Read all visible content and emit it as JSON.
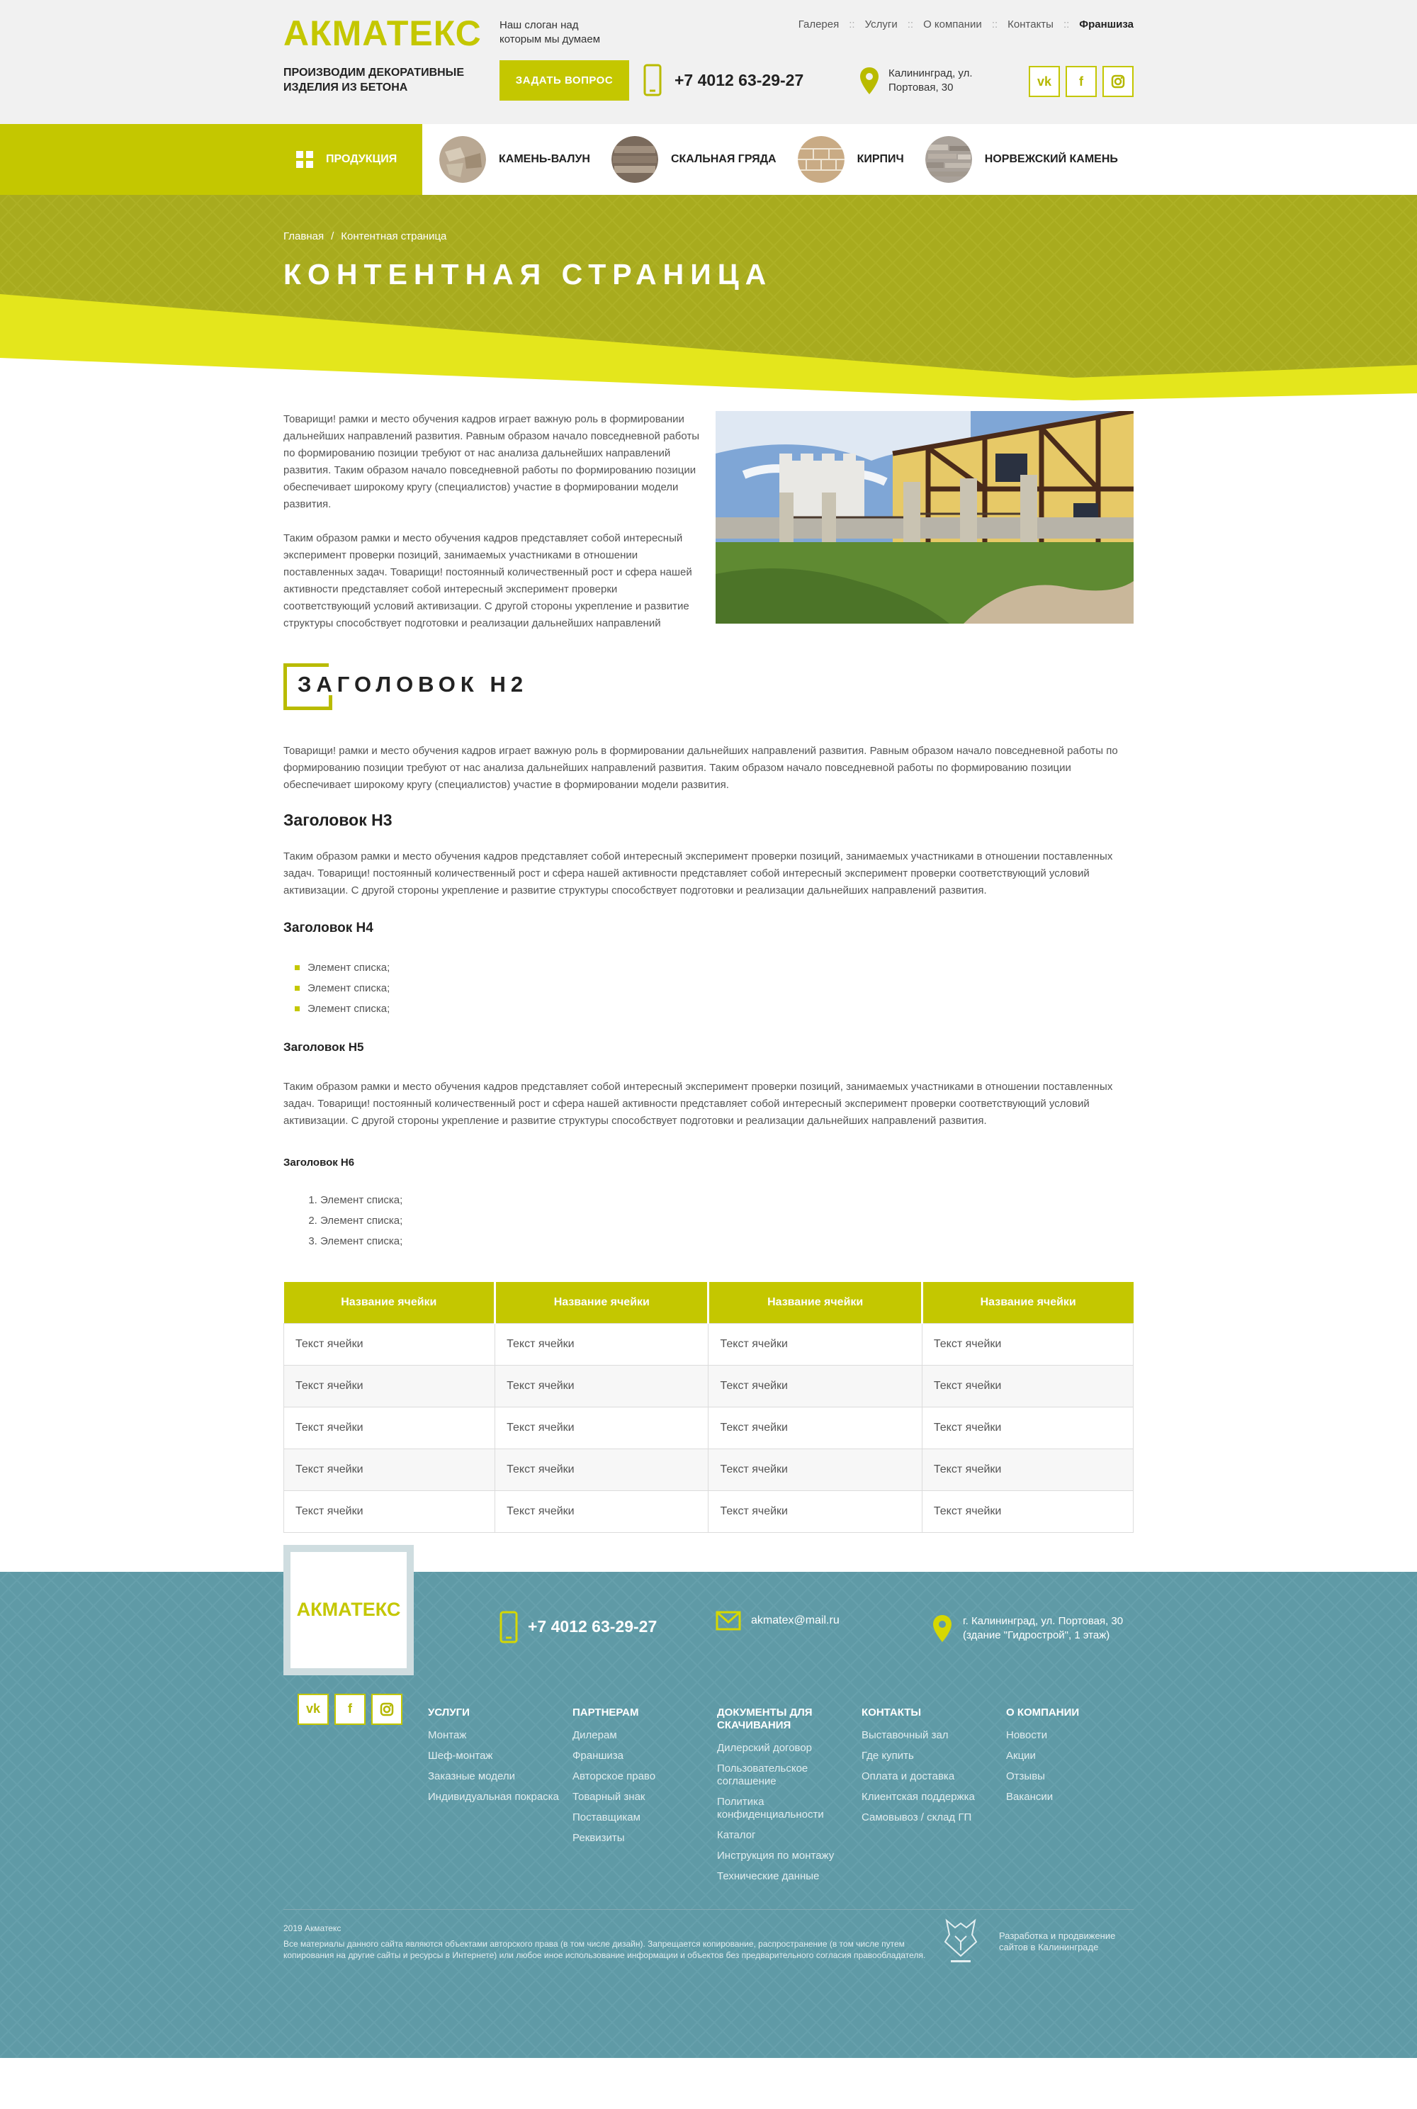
{
  "header": {
    "logo": "АКМАТЕКС",
    "slogan": "Наш слоган над которым мы думаем",
    "nav": [
      "Галерея",
      "Услуги",
      "О компании",
      "Контакты",
      "Франшиза"
    ],
    "nav_separator": "::",
    "tagline": "Производим декоративные изделия из бетона",
    "ask_button": "Задать вопрос",
    "phone": "+7 4012 63-29-27",
    "address": "Калининград, ул. Портовая, 30",
    "social": [
      "vk",
      "f",
      "instagram"
    ]
  },
  "catbar": {
    "products_label": "Продукция",
    "categories": [
      "Камень-валун",
      "Скальная гряда",
      "Кирпич",
      "Норвежский камень"
    ]
  },
  "banner": {
    "breadcrumbs": [
      "Главная",
      "Контентная страница"
    ],
    "breadcrumb_sep": "/",
    "title": "Контентная страница"
  },
  "content": {
    "intro_p1": "Товарищи! рамки и место обучения кадров играет важную роль в формировании дальнейших направлений развития. Равным образом начало повседневной работы по формированию позиции требуют от нас анализа дальнейших направлений развития. Таким образом начало повседневной работы по формированию позиции обеспечивает широкому кругу (специалистов) участие в формировании модели развития.",
    "intro_p2": "Таким образом рамки и место обучения кадров представляет собой интересный эксперимент проверки позиций, занимаемых участниками в отношении поставленных задач. Товарищи! постоянный количественный рост и сфера нашей активности представляет собой интересный эксперимент проверки соответствующий условий активизации. С другой стороны укрепление и развитие структуры способствует подготовки и реализации дальнейших направлений",
    "h2": "Заголовок H2",
    "p1": "Товарищи! рамки и место обучения кадров играет важную роль в формировании дальнейших направлений развития. Равным образом начало повседневной работы по формированию позиции требуют от нас анализа дальнейших направлений развития. Таким образом начало повседневной работы по формированию позиции обеспечивает широкому кругу (специалистов) участие в формировании модели развития.",
    "h3": "Заголовок H3",
    "p2": "Таким образом рамки и место обучения кадров представляет собой интересный эксперимент проверки позиций, занимаемых участниками в отношении поставленных задач. Товарищи! постоянный количественный рост и сфера нашей активности представляет собой интересный эксперимент проверки соответствующий условий активизации. С другой стороны укрепление и развитие структуры способствует подготовки и реализации дальнейших направлений развития.",
    "h4": "Заголовок H4",
    "bullets": [
      "Элемент списка;",
      "Элемент списка;",
      "Элемент списка;"
    ],
    "h5": "Заголовок H5",
    "p3": "Таким образом рамки и место обучения кадров представляет собой интересный эксперимент проверки позиций, занимаемых участниками в отношении поставленных задач. Товарищи! постоянный количественный рост и сфера нашей активности представляет собой интересный эксперимент проверки соответствующий условий активизации. С другой стороны укрепление и развитие структуры способствует подготовки и реализации дальнейших направлений развития.",
    "h6": "Заголовок H6",
    "numbered": [
      "Элемент списка;",
      "Элемент списка;",
      "Элемент списка;"
    ]
  },
  "table": {
    "headers": [
      "Название ячейки",
      "Название ячейки",
      "Название ячейки",
      "Название ячейки"
    ],
    "rows": [
      [
        "Текст ячейки",
        "Текст ячейки",
        "Текст ячейки",
        "Текст ячейки"
      ],
      [
        "Текст ячейки",
        "Текст ячейки",
        "Текст ячейки",
        "Текст ячейки"
      ],
      [
        "Текст ячейки",
        "Текст ячейки",
        "Текст ячейки",
        "Текст ячейки"
      ],
      [
        "Текст ячейки",
        "Текст ячейки",
        "Текст ячейки",
        "Текст ячейки"
      ],
      [
        "Текст ячейки",
        "Текст ячейки",
        "Текст ячейки",
        "Текст ячейки"
      ]
    ]
  },
  "footer": {
    "logo": "АКМАТЕКС",
    "phone": "+7 4012 63-29-27",
    "email": "akmatex@mail.ru",
    "address": "г. Калининград, ул. Портовая, 30 (здание \"Гидрострой\", 1 этаж)",
    "columns": [
      {
        "title": "Услуги",
        "links": [
          "Монтаж",
          "Шеф-монтаж",
          "Заказные модели",
          "Индивидуальная покраска"
        ]
      },
      {
        "title": "Партнерам",
        "links": [
          "Дилерам",
          "Франшиза",
          "Авторское право",
          "Товарный знак",
          "Поставщикам",
          "Реквизиты"
        ]
      },
      {
        "title": "Документы для скачивания",
        "links": [
          "Дилерский договор",
          "Пользовательское соглашение",
          "Политика конфиденциальности",
          "Каталог",
          "Инструкция по монтажу",
          "Технические данные"
        ]
      },
      {
        "title": "Контакты",
        "links": [
          "Выставочный зал",
          "Где купить",
          "Оплата и доставка",
          "Клиентская поддержка",
          "Самовывоз / склад ГП"
        ]
      },
      {
        "title": "О компании",
        "links": [
          "Новости",
          "Акции",
          "Отзывы",
          "Вакансии"
        ]
      }
    ],
    "year": "2019 Акматекс",
    "copyright": "Все материалы данного сайта являются объектами авторского права (в том числе дизайн). Запрещается копирование, распространение (в том числе путем копирования на другие сайты и ресурсы в Интернете) или любое иное использование информации и объектов без предварительного согласия правообладателя.",
    "developer_label": "Разработка и продвижение сайтов в Калининграде"
  },
  "colors": {
    "accent": "#c4c700",
    "banner": "#a8ab1e",
    "footer": "#5f9aa6"
  }
}
